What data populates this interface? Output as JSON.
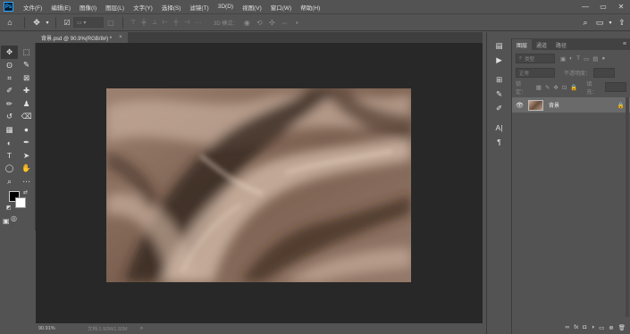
{
  "app": {
    "logo_text": "Ps",
    "menu": [
      "文件(F)",
      "编辑(E)",
      "图像(I)",
      "图层(L)",
      "文字(Y)",
      "选择(S)",
      "滤镜(T)",
      "3D(D)",
      "视图(V)",
      "窗口(W)",
      "帮助(H)"
    ],
    "window_controls": {
      "minimize": "—",
      "maximize": "▭",
      "close": "✕"
    }
  },
  "options_bar": {
    "home_icon": "home-icon",
    "move_icon": "move-tool-icon",
    "auto_select_label": "",
    "mode_label": "3D 模式：",
    "search_icon": "search-icon",
    "workspace_icon": "workspace-icon",
    "share_icon": "share-icon"
  },
  "document": {
    "tab_title": "背景.psd @ 90.9%(RGB/8#) *",
    "tab_close": "×",
    "image_description_color": "#8c7260"
  },
  "status": {
    "zoom": "90.91%",
    "doc_info": "文档:1.92M/1.92M",
    "arrow": ">"
  },
  "tools": [
    "move-tool-icon",
    "marquee-tool-icon",
    "lasso-tool-icon",
    "magic-wand-tool-icon",
    "crop-tool-icon",
    "frame-tool-icon",
    "eyedropper-tool-icon",
    "healing-brush-tool-icon",
    "brush-tool-icon",
    "clone-stamp-tool-icon",
    "history-brush-tool-icon",
    "eraser-tool-icon",
    "gradient-tool-icon",
    "blur-tool-icon",
    "dodge-tool-icon",
    "pen-tool-icon",
    "type-tool-icon",
    "path-selection-tool-icon",
    "ellipse-tool-icon",
    "hand-tool-icon",
    "zoom-tool-icon",
    "more-tools-icon"
  ],
  "tool_glyphs": [
    "✥",
    "⬚",
    "ʘ",
    "✎",
    "⌗",
    "⊠",
    "✐",
    "✚",
    "✏",
    "♟",
    "↺",
    "⌫",
    "▦",
    "●",
    "◐",
    "✒",
    "T",
    "➤",
    "◯",
    "✋",
    "⌕",
    "⋯"
  ],
  "colors": {
    "foreground": "#000000",
    "background": "#ffffff",
    "swap_glyph": "⇄",
    "default_glyph": "◩",
    "quickmask_glyph": "◎",
    "screenmode_glyph": "▣"
  },
  "right_icons": [
    "history-icon",
    "play-actions-icon",
    "properties-icon",
    "brush-settings-icon",
    "paths-icon",
    "character-icon",
    "paragraph-icon"
  ],
  "right_glyphs": [
    "▤",
    "▶",
    "⊞",
    "✎",
    "✐",
    "A|",
    "¶"
  ],
  "layers_panel": {
    "tabs": [
      "图层",
      "通道",
      "路径"
    ],
    "menu_glyph": "≡",
    "filter_label": "类型",
    "blend_mode": "正常",
    "opacity_label": "不透明度：",
    "lock_label": "锁定：",
    "fill_label": "填充：",
    "layers": [
      {
        "name": "背景",
        "visible_glyph": "👁",
        "locked_glyph": "🔒"
      }
    ],
    "footer_icons": [
      "link-icon",
      "fx-icon",
      "mask-icon",
      "adjustment-icon",
      "group-icon",
      "new-layer-icon",
      "delete-icon"
    ],
    "footer_glyphs": [
      "∞",
      "fx",
      "◘",
      "◑",
      "▭",
      "⊕",
      "🗑"
    ]
  }
}
